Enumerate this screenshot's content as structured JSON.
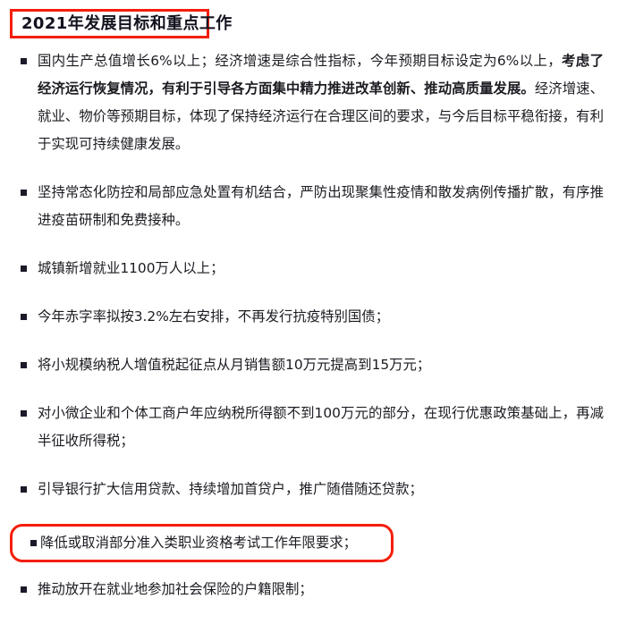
{
  "document": {
    "title": "2021年发展目标和重点工作",
    "title_box_color": "#f41e09",
    "title_text_color": "#13131f",
    "body_text_color": "#1b1b22",
    "bullet_glyph": "square-bullet"
  },
  "items": [
    {
      "id": "gdp-growth-target",
      "bullet": "■",
      "segments": [
        {
          "text": "国内生产总值增长6%以上；经济增速是综合性指标，今年预期目标设定为6%以上，",
          "bold": false
        },
        {
          "text": "考虑了经济运行恢复情况，有利于引导各方面集中精力推进改革创新、推动高质量发展。",
          "bold": true
        },
        {
          "text": "经济增速、就业、物价等预期目标，体现了保持经济运行在合理区间的要求，与今后目标平稳衔接，有利于实现可持续健康发展。",
          "bold": false
        }
      ],
      "plain": "国内生产总值增长6%以上；经济增速是综合性指标，今年预期目标设定为6%以上，考虑了经济运行恢复情况，有利于引导各方面集中精力推进改革创新、推动高质量发展。经济增速、就业、物价等预期目标，体现了保持经济运行在合理区间的要求，与今后目标平稳衔接，有利于实现可持续健康发展。",
      "highlighted": false
    },
    {
      "id": "epidemic-prevention",
      "bullet": "■",
      "segments": [
        {
          "text": "坚持常态化防控和局部应急处置有机结合，严防出现聚集性疫情和散发病例传播扩散，有序推进疫苗研制和免费接种。",
          "bold": false
        }
      ],
      "plain": "坚持常态化防控和局部应急处置有机结合，严防出现聚集性疫情和散发病例传播扩散，有序推进疫苗研制和免费接种。",
      "highlighted": false
    },
    {
      "id": "urban-new-jobs",
      "bullet": "■",
      "segments": [
        {
          "text": "城镇新增就业1100万人以上；",
          "bold": false
        }
      ],
      "plain": "城镇新增就业1100万人以上；",
      "highlighted": false
    },
    {
      "id": "deficit-ratio",
      "bullet": "■",
      "segments": [
        {
          "text": "今年赤字率拟按3.2%左右安排，不再发行抗疫特别国债；",
          "bold": false
        }
      ],
      "plain": "今年赤字率拟按3.2%左右安排，不再发行抗疫特别国债；",
      "highlighted": false
    },
    {
      "id": "vat-threshold",
      "bullet": "■",
      "segments": [
        {
          "text": "将小规模纳税人增值税起征点从月销售额10万元提高到15万元；",
          "bold": false
        }
      ],
      "plain": "将小规模纳税人增值税起征点从月销售额10万元提高到15万元；",
      "highlighted": false
    },
    {
      "id": "small-business-tax",
      "bullet": "■",
      "segments": [
        {
          "text": "对小微企业和个体工商户年应纳税所得额不到100万元的部分，在现行优惠政策基础上，再减半征收所得税；",
          "bold": false
        }
      ],
      "plain": "对小微企业和个体工商户年应纳税所得额不到100万元的部分，在现行优惠政策基础上，再减半征收所得税；",
      "highlighted": false
    },
    {
      "id": "bank-credit-loans",
      "bullet": "■",
      "segments": [
        {
          "text": "引导银行扩大信用贷款、持续增加首贷户，推广随借随还贷款；",
          "bold": false
        }
      ],
      "plain": "引导银行扩大信用贷款、持续增加首贷户，推广随借随还贷款；",
      "highlighted": false
    },
    {
      "id": "professional-qualification-years",
      "bullet": "■",
      "segments": [
        {
          "text": "降低或取消部分准入类职业资格考试工作年限要求；",
          "bold": false
        }
      ],
      "plain": "降低或取消部分准入类职业资格考试工作年限要求；",
      "highlighted": true
    },
    {
      "id": "social-insurance-hukou",
      "bullet": "■",
      "segments": [
        {
          "text": "推动放开在就业地参加社会保险的户籍限制；",
          "bold": false
        }
      ],
      "plain": "推动放开在就业地参加社会保险的户籍限制；",
      "highlighted": false
    }
  ]
}
